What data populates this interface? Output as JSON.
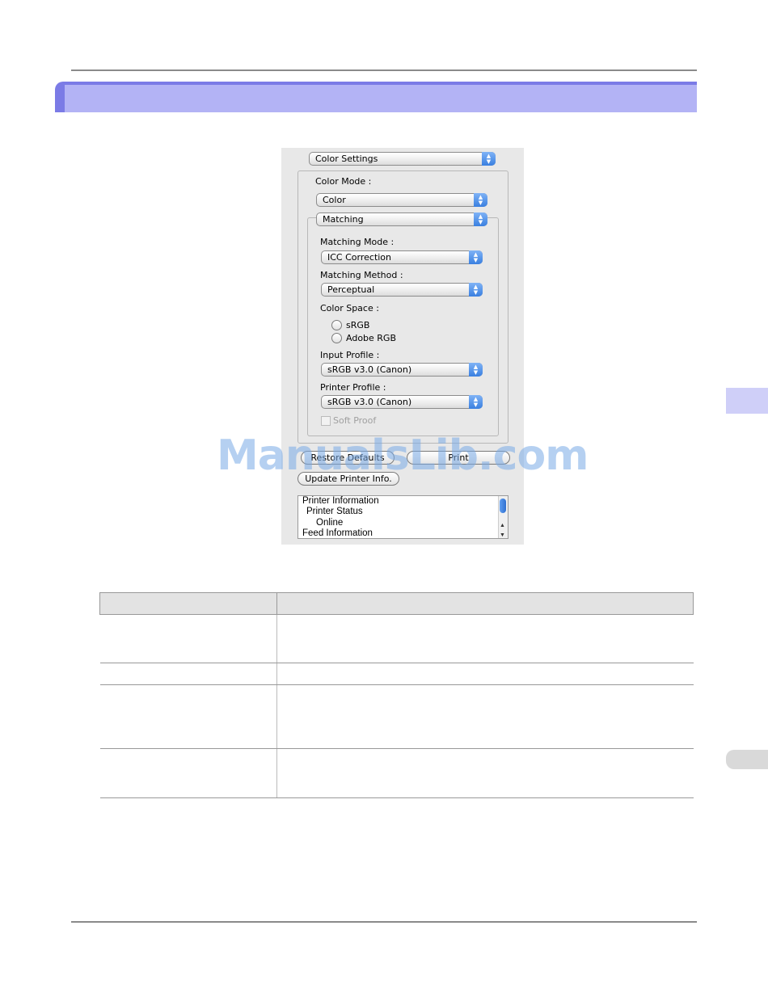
{
  "dialog": {
    "color_settings_popup": "Color Settings",
    "color_mode_label": "Color Mode :",
    "color_mode_value": "Color",
    "matching_popup": "Matching",
    "matching_mode_label": "Matching Mode :",
    "matching_mode_value": "ICC Correction",
    "matching_method_label": "Matching Method :",
    "matching_method_value": "Perceptual",
    "color_space_label": "Color Space :",
    "color_space_options": [
      "sRGB",
      "Adobe RGB"
    ],
    "input_profile_label": "Input Profile :",
    "input_profile_value": "sRGB v3.0 (Canon)",
    "printer_profile_label": "Printer Profile :",
    "printer_profile_value": "sRGB v3.0 (Canon)",
    "soft_proof_label": "Soft Proof",
    "restore_defaults_label": "Restore Defaults",
    "print_label": "Print",
    "update_printer_info_label": "Update Printer Info.",
    "info_lines": [
      "Printer Information",
      "Printer Status",
      "Online",
      "Feed Information"
    ]
  },
  "watermark": "ManualsLib.com",
  "table": {
    "rows": 4
  }
}
